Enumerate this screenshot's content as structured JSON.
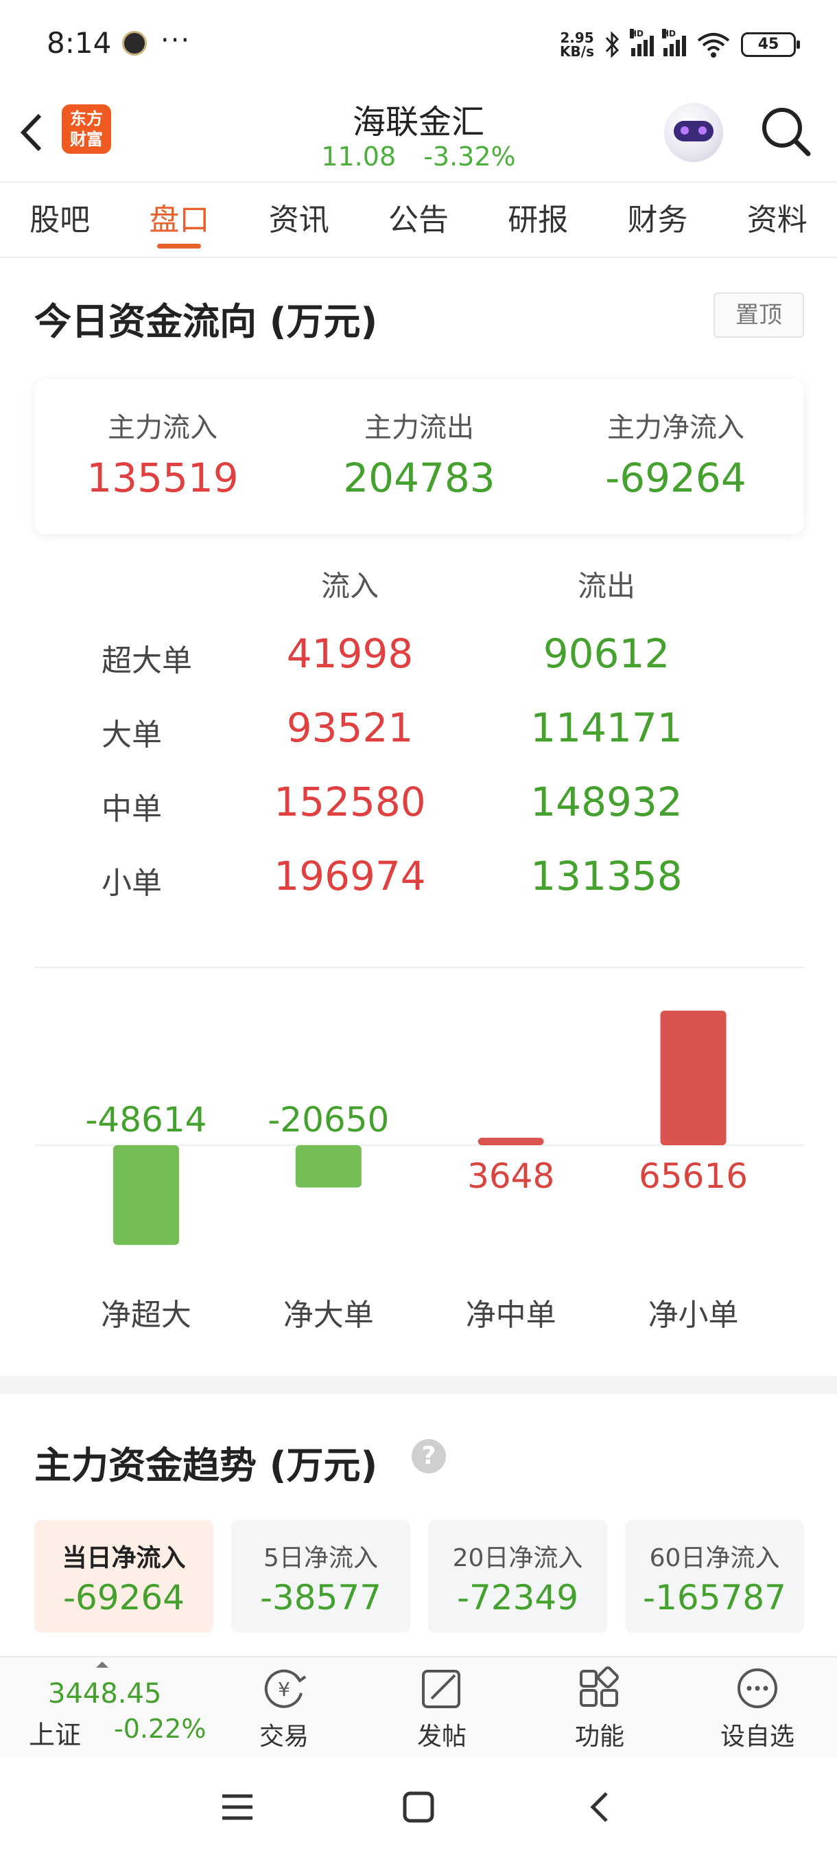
{
  "status_bar": {
    "time": "8:14",
    "dots": "···",
    "net_speed_value": "2.95",
    "net_speed_unit": "KB/s",
    "signal_tag": "HD",
    "battery": "45"
  },
  "header": {
    "brand_logo": "东方财富",
    "stock_name": "海联金汇",
    "price": "11.08",
    "change_pct": "-3.32%"
  },
  "tabs": [
    "股吧",
    "盘口",
    "资讯",
    "公告",
    "研报",
    "财务",
    "资料"
  ],
  "active_tab": "盘口",
  "fund_flow": {
    "title": "今日资金流向 (万元)",
    "pin_button": "置顶",
    "summary": [
      {
        "label": "主力流入",
        "value": "135519",
        "color": "red"
      },
      {
        "label": "主力流出",
        "value": "204783",
        "color": "green"
      },
      {
        "label": "主力净流入",
        "value": "-69264",
        "color": "green"
      }
    ],
    "table": {
      "headers": [
        "流入",
        "流出"
      ],
      "rows": [
        {
          "label": "超大单",
          "in": "41998",
          "out": "90612"
        },
        {
          "label": "大单",
          "in": "93521",
          "out": "114171"
        },
        {
          "label": "中单",
          "in": "152580",
          "out": "148932"
        },
        {
          "label": "小单",
          "in": "196974",
          "out": "131358"
        }
      ]
    }
  },
  "chart_data": {
    "type": "bar",
    "categories": [
      "净超大",
      "净大单",
      "净中单",
      "净小单"
    ],
    "values": [
      -48614,
      -20650,
      3648,
      65616
    ],
    "value_labels": [
      "-48614",
      "-20650",
      "3648",
      "65616"
    ],
    "positive_color": "#d9534f",
    "negative_color": "#74bc54",
    "title": "",
    "xlabel": "",
    "ylabel": ""
  },
  "trend": {
    "title": "主力资金趋势 (万元)",
    "help_icon": "question-icon",
    "tabs": [
      {
        "label": "当日净流入",
        "value": "-69264",
        "active": true
      },
      {
        "label": "5日净流入",
        "value": "-38577",
        "active": false
      },
      {
        "label": "20日净流入",
        "value": "-72349",
        "active": false
      },
      {
        "label": "60日净流入",
        "value": "-165787",
        "active": false
      }
    ]
  },
  "bottom_bar": {
    "index_value": "3448.45",
    "index_name": "上证",
    "index_change": "-0.22%",
    "tools": [
      {
        "label": "交易",
        "icon": "trade-icon"
      },
      {
        "label": "发帖",
        "icon": "compose-icon"
      },
      {
        "label": "功能",
        "icon": "apps-icon"
      },
      {
        "label": "设自选",
        "icon": "more-icon"
      }
    ]
  },
  "colors": {
    "accent": "#e8602c",
    "up": "#e04040",
    "down": "#45a12e"
  }
}
